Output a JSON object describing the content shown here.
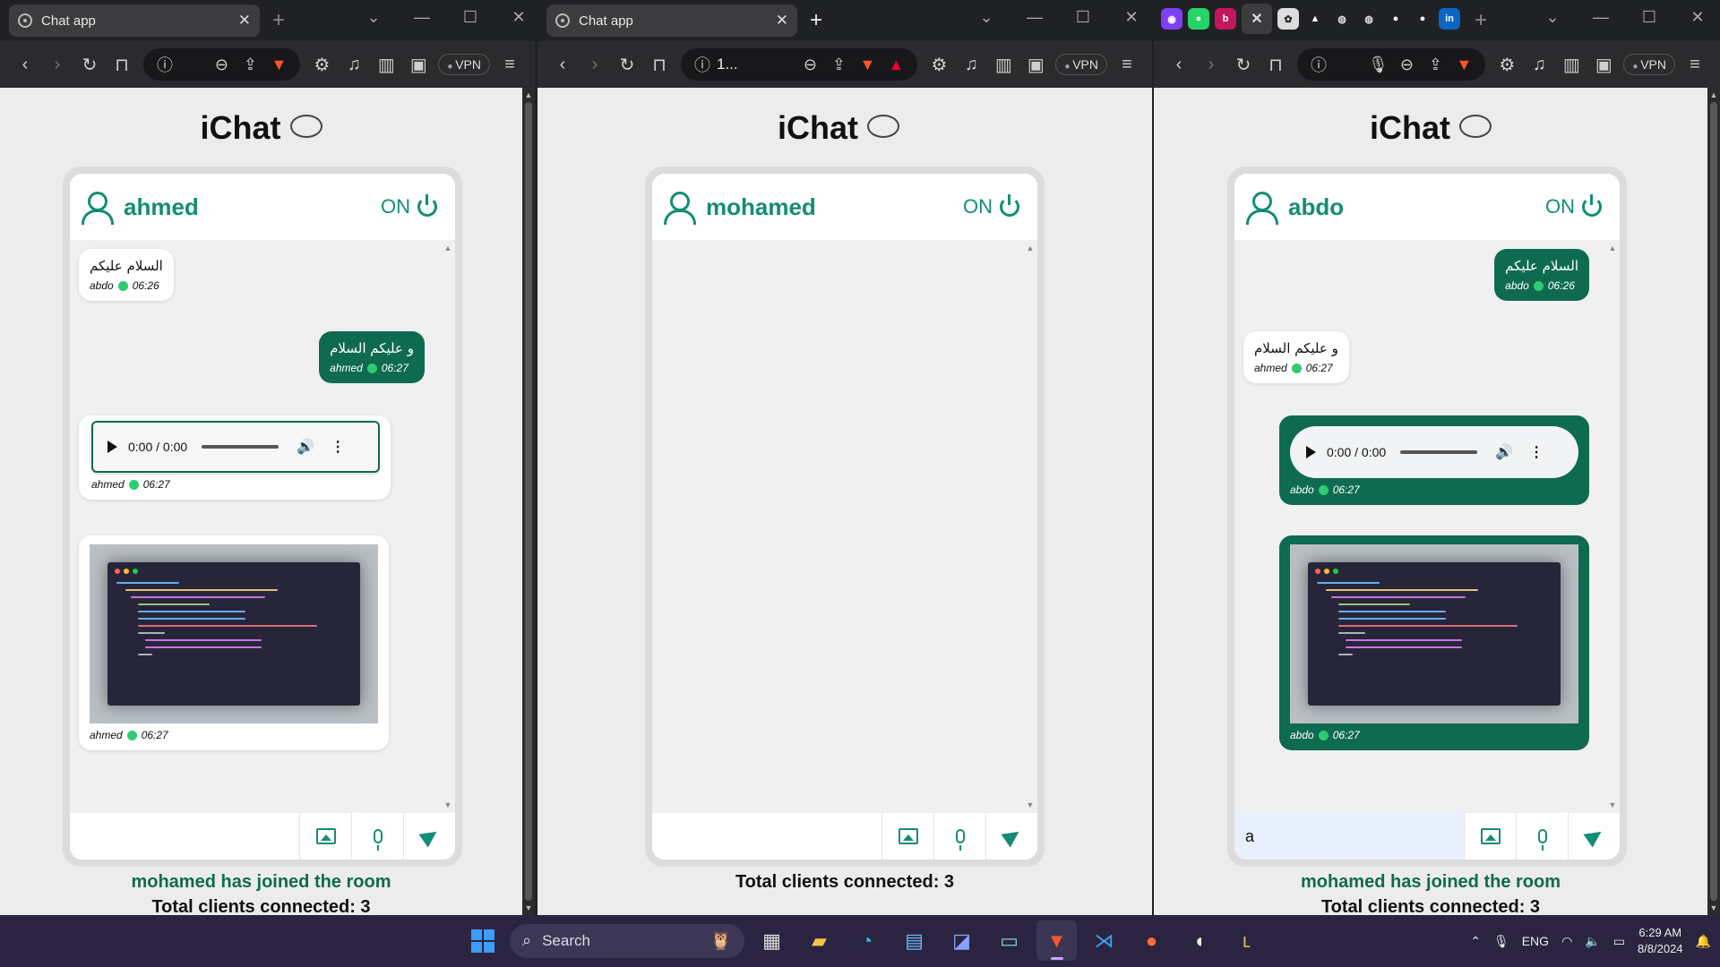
{
  "windows": [
    {
      "tab_title": "Chat app",
      "address": "",
      "user": "ahmed",
      "status": "ON",
      "input_value": "",
      "messages": [
        {
          "text": "السلام عليكم",
          "sender": "abdo",
          "time": "06:26"
        },
        {
          "text": "و عليكم السلام",
          "sender": "ahmed",
          "time": "06:27"
        },
        {
          "audio_time": "0:00 / 0:00",
          "sender": "ahmed",
          "time": "06:27"
        },
        {
          "sender": "ahmed",
          "time": "06:27"
        }
      ],
      "join_notice": "mohamed has joined the room",
      "total_clients": "Total clients connected: 3"
    },
    {
      "tab_title": "Chat app",
      "address": "1...",
      "user": "mohamed",
      "status": "ON",
      "input_value": "",
      "messages": [],
      "join_notice": "",
      "total_clients": "Total clients connected: 3"
    },
    {
      "tab_title": "",
      "address": "",
      "user": "abdo",
      "status": "ON",
      "input_value": "a",
      "messages": [
        {
          "text": "السلام عليكم",
          "sender": "abdo",
          "time": "06:26"
        },
        {
          "text": "و عليكم السلام",
          "sender": "ahmed",
          "time": "06:27"
        },
        {
          "audio_time": "0:00 / 0:00",
          "sender": "abdo",
          "time": "06:27"
        },
        {
          "sender": "abdo",
          "time": "06:27"
        }
      ],
      "join_notice": "mohamed has joined the room",
      "total_clients": "Total clients connected: 3"
    }
  ],
  "app_title": "iChat",
  "vpn_label": "VPN",
  "taskbar": {
    "search_label": "Search",
    "language": "ENG",
    "time": "6:29 AM",
    "date": "8/8/2024"
  },
  "colors": {
    "accent": "#138d75",
    "outgoing_bubble": "#0f6b4f",
    "online_dot": "#2ecc71",
    "taskbar": "#2a2440"
  }
}
